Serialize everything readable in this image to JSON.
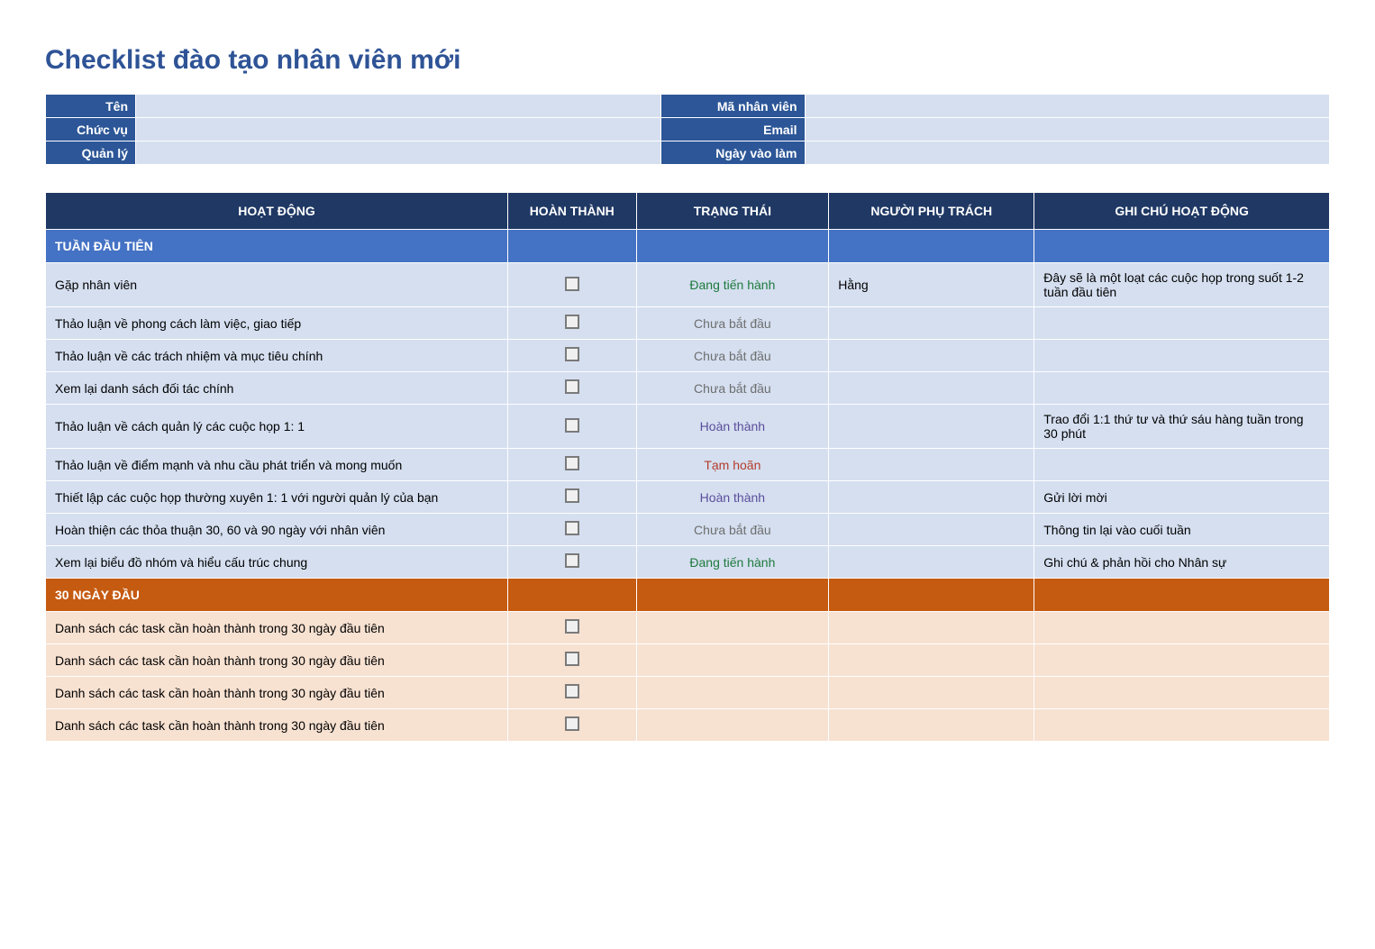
{
  "title": "Checklist đào tạo nhân viên mới",
  "info": {
    "labels": {
      "name": "Tên",
      "code": "Mã nhân viên",
      "position": "Chức vụ",
      "email": "Email",
      "manager": "Quản lý",
      "startdate": "Ngày vào làm"
    },
    "values": {
      "name": "",
      "code": "",
      "position": "",
      "email": "",
      "manager": "",
      "startdate": ""
    }
  },
  "headers": {
    "activity": "HOẠT ĐỘNG",
    "complete": "HOÀN THÀNH",
    "status": "TRẠNG THÁI",
    "responsible": "NGƯỜI PHỤ TRÁCH",
    "notes": "GHI CHÚ HOẠT ĐỘNG"
  },
  "sections": {
    "week1": "TUẦN ĐẦU TIÊN",
    "days30": "30 NGÀY ĐẦU"
  },
  "statusLabels": {
    "progress": "Đang tiến hành",
    "notstarted": "Chưa bắt đầu",
    "complete": "Hoàn thành",
    "postponed": "Tạm hoãn"
  },
  "week1_rows": [
    {
      "activity": "Gặp nhân viên",
      "status": "progress",
      "responsible": "Hằng",
      "notes": "Đây sẽ là một loạt các cuộc họp trong suốt 1-2 tuần đầu tiên"
    },
    {
      "activity": "Thảo luận về phong cách làm việc, giao tiếp",
      "status": "notstarted",
      "responsible": "",
      "notes": ""
    },
    {
      "activity": "Thảo luận về các trách nhiệm và mục tiêu chính",
      "status": "notstarted",
      "responsible": "",
      "notes": ""
    },
    {
      "activity": "Xem lại danh sách đối tác chính",
      "status": "notstarted",
      "responsible": "",
      "notes": ""
    },
    {
      "activity": "Thảo luận về cách quản lý các cuộc họp 1: 1",
      "status": "complete",
      "responsible": "",
      "notes": "Trao đổi 1:1  thứ tư và thứ sáu hàng tuần trong 30 phút"
    },
    {
      "activity": "Thảo luận về điểm mạnh và nhu cầu phát triển và mong muốn",
      "status": "postponed",
      "responsible": "",
      "notes": ""
    },
    {
      "activity": "Thiết lập các cuộc họp thường xuyên 1: 1 với người quản lý của bạn",
      "status": "complete",
      "responsible": "",
      "notes": "Gửi lời mời"
    },
    {
      "activity": "Hoàn thiện các thỏa thuận 30, 60 và 90 ngày với nhân viên",
      "status": "notstarted",
      "responsible": "",
      "notes": "Thông tin lại vào cuối tuần"
    },
    {
      "activity": "Xem lại biểu đồ nhóm và hiểu cấu trúc chung",
      "status": "progress",
      "responsible": "",
      "notes": "Ghi chú & phản hồi cho Nhân sự"
    }
  ],
  "days30_rows": [
    {
      "activity": "Danh sách các task cần hoàn thành trong 30 ngày đầu tiên",
      "status": "",
      "responsible": "",
      "notes": ""
    },
    {
      "activity": "Danh sách các task cần hoàn thành trong 30 ngày đầu tiên",
      "status": "",
      "responsible": "",
      "notes": ""
    },
    {
      "activity": "Danh sách các task cần hoàn thành trong 30 ngày đầu tiên",
      "status": "",
      "responsible": "",
      "notes": ""
    },
    {
      "activity": "Danh sách các task cần hoàn thành trong 30 ngày đầu tiên",
      "status": "",
      "responsible": "",
      "notes": ""
    }
  ]
}
